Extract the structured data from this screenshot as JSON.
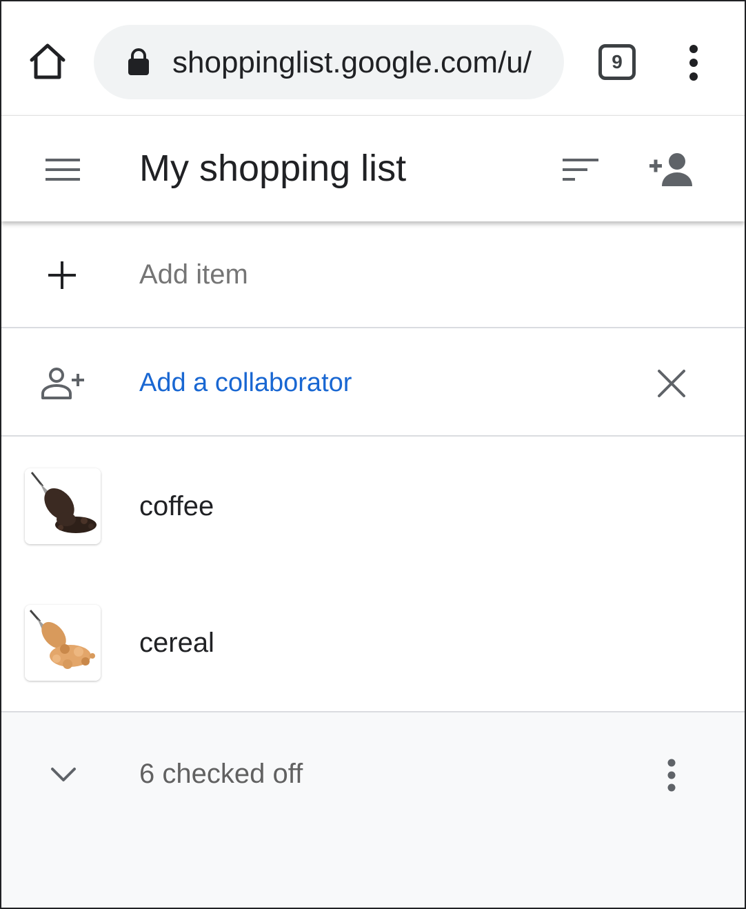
{
  "browser": {
    "url": "shoppinglist.google.com/u/",
    "tab_count": "9"
  },
  "header": {
    "title": "My shopping list"
  },
  "add_item": {
    "placeholder": "Add item"
  },
  "collaborator_banner": {
    "label": "Add a collaborator"
  },
  "items": [
    {
      "label": "coffee",
      "image_icon": "coffee-beans-scoop"
    },
    {
      "label": "cereal",
      "image_icon": "cereal-scoop"
    }
  ],
  "checked_section": {
    "label": "6 checked off"
  },
  "colors": {
    "link_blue": "#1967d2",
    "icon_gray": "#5f6368",
    "divider": "#dadce0",
    "omnibox_bg": "#f1f3f4",
    "checked_bg": "#f8f9fa"
  }
}
